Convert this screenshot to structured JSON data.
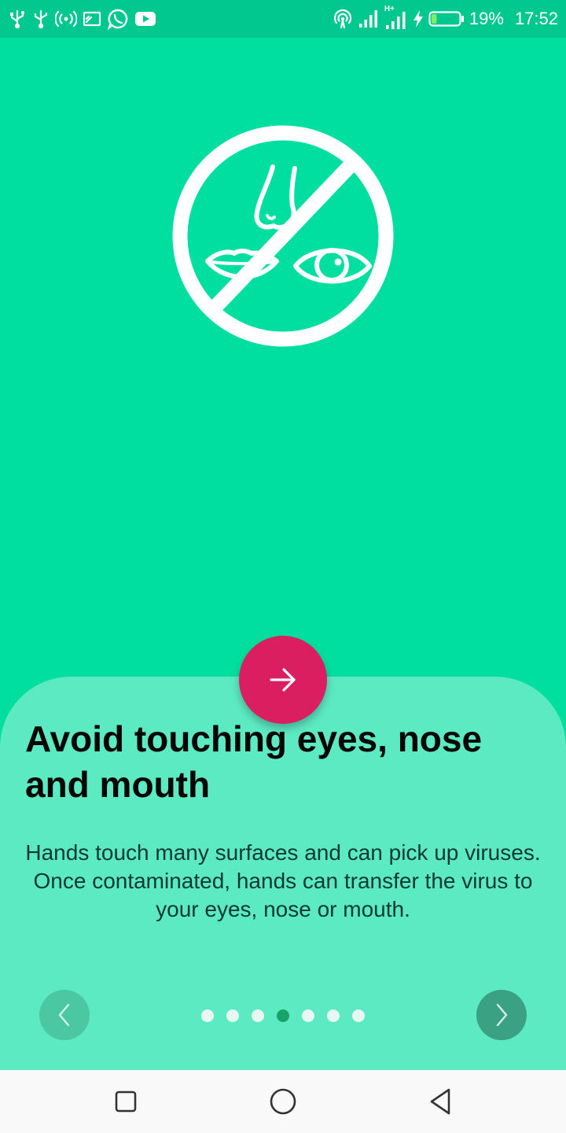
{
  "status_bar": {
    "left_icons": [
      "usb-icon",
      "usb-icon",
      "hotspot-icon",
      "cast-icon",
      "whatsapp-icon",
      "youtube-icon"
    ],
    "right_icons": [
      "wifi-hotspot-icon",
      "signal-icon",
      "signal-hplus-icon",
      "charging-icon",
      "battery-icon"
    ],
    "network_label": "H+",
    "battery_percent": "19%",
    "time": "17:52",
    "battery_level": 0.19
  },
  "hero": {
    "icon": "no-touch-face-icon"
  },
  "slide": {
    "title": "Avoid touching eyes, nose and mouth",
    "body": "Hands touch many surfaces and can pick up viruses. Once contaminated, hands can transfer the virus to your eyes, nose or mouth.",
    "next_fab_icon": "arrow-right-icon"
  },
  "pager": {
    "total_pages": 7,
    "current_page": 4,
    "prev_icon": "chevron-left-icon",
    "next_icon": "chevron-right-icon"
  },
  "system_nav": {
    "icons": [
      "recents-square-icon",
      "home-circle-icon",
      "back-triangle-icon"
    ]
  },
  "colors": {
    "background": "#00df9f",
    "status_bar": "#00c88f",
    "sheet": "#5ceac2",
    "fab": "#db1e60",
    "active_dot": "#17a36a"
  }
}
